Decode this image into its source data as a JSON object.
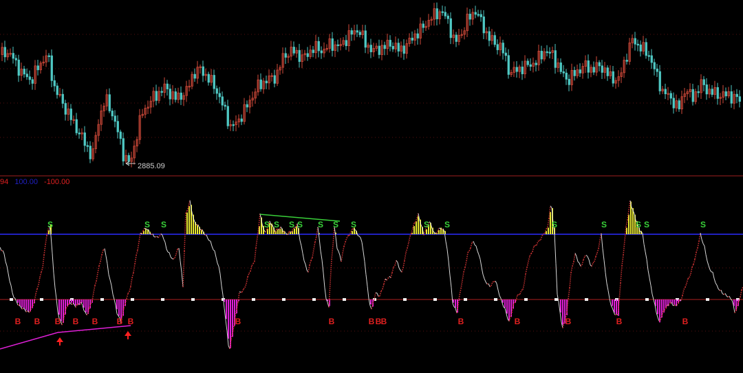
{
  "header": {
    "indicator_value": "94",
    "upper_level": "100.00",
    "lower_level": "-100.00"
  },
  "colors": {
    "background": "#000000",
    "candle_up": "#d24a3a",
    "candle_down": "#4fc9c4",
    "indicator_line": "#d8d8d8",
    "rising_dots": "#c83232",
    "sell_bars": "#e8e832",
    "buy_bars": "#e020d8",
    "sell_label": "#39d039",
    "buy_label": "#e02020",
    "upper_line": "#2020c0",
    "zero_line": "#b02020",
    "divergence_line_top": "#39d039",
    "divergence_line_bottom": "#e020d8",
    "arrow": "#ff2020"
  },
  "chart_data": [
    {
      "type": "candlestick",
      "panel": "price",
      "annotation": {
        "label": "2885.09",
        "points_to": "lowest low"
      },
      "close_path": [
        [
          0,
          3035
        ],
        [
          8,
          3040
        ],
        [
          18,
          3030
        ],
        [
          30,
          3010
        ],
        [
          45,
          3000
        ],
        [
          55,
          3020
        ],
        [
          68,
          3035
        ],
        [
          78,
          2990
        ],
        [
          92,
          2965
        ],
        [
          110,
          2935
        ],
        [
          125,
          2910
        ],
        [
          133,
          2895
        ],
        [
          142,
          2945
        ],
        [
          152,
          2975
        ],
        [
          160,
          2960
        ],
        [
          170,
          2930
        ],
        [
          178,
          2900
        ],
        [
          188,
          2885
        ],
        [
          195,
          2915
        ],
        [
          205,
          2955
        ],
        [
          220,
          2975
        ],
        [
          238,
          2990
        ],
        [
          255,
          2975
        ],
        [
          270,
          2985
        ],
        [
          280,
          3010
        ],
        [
          290,
          3015
        ],
        [
          300,
          3005
        ],
        [
          312,
          2990
        ],
        [
          325,
          2960
        ],
        [
          335,
          2935
        ],
        [
          345,
          2945
        ],
        [
          358,
          2965
        ],
        [
          372,
          2990
        ],
        [
          385,
          3000
        ],
        [
          400,
          3005
        ],
        [
          412,
          3035
        ],
        [
          425,
          3040
        ],
        [
          440,
          3030
        ],
        [
          455,
          3045
        ],
        [
          468,
          3040
        ],
        [
          480,
          3050
        ],
        [
          492,
          3045
        ],
        [
          505,
          3060
        ],
        [
          520,
          3070
        ],
        [
          530,
          3050
        ],
        [
          542,
          3040
        ],
        [
          555,
          3045
        ],
        [
          568,
          3050
        ],
        [
          580,
          3040
        ],
        [
          592,
          3050
        ],
        [
          600,
          3060
        ],
        [
          612,
          3070
        ],
        [
          625,
          3085
        ],
        [
          640,
          3095
        ],
        [
          650,
          3080
        ],
        [
          660,
          3050
        ],
        [
          670,
          3065
        ],
        [
          680,
          3085
        ],
        [
          690,
          3095
        ],
        [
          698,
          3080
        ],
        [
          708,
          3060
        ],
        [
          718,
          3050
        ],
        [
          728,
          3045
        ],
        [
          740,
          3010
        ],
        [
          752,
          3015
        ],
        [
          765,
          3020
        ],
        [
          778,
          3025
        ],
        [
          790,
          3040
        ],
        [
          802,
          3035
        ],
        [
          815,
          3010
        ],
        [
          825,
          3000
        ],
        [
          835,
          3010
        ],
        [
          848,
          3020
        ],
        [
          860,
          3015
        ],
        [
          872,
          3020
        ],
        [
          885,
          3005
        ],
        [
          898,
          3000
        ],
        [
          908,
          3030
        ],
        [
          918,
          3055
        ],
        [
          930,
          3045
        ],
        [
          942,
          3035
        ],
        [
          952,
          3010
        ],
        [
          962,
          2985
        ],
        [
          975,
          2975
        ],
        [
          985,
          2960
        ],
        [
          995,
          2990
        ],
        [
          1005,
          2975
        ],
        [
          1018,
          2995
        ],
        [
          1030,
          2985
        ],
        [
          1045,
          2980
        ],
        [
          1058,
          2980
        ],
        [
          1070,
          2975
        ],
        [
          1080,
          2970
        ]
      ]
    },
    {
      "type": "line",
      "panel": "indicator",
      "levels": {
        "upper": 100.0,
        "zero": 0,
        "lower": -100.0
      },
      "series": [
        {
          "values": [
            [
              0,
              80
            ],
            [
              6,
              70
            ],
            [
              12,
              40
            ],
            [
              18,
              10
            ],
            [
              22,
              0
            ],
            [
              28,
              -10
            ],
            [
              35,
              -15
            ],
            [
              42,
              -20
            ],
            [
              48,
              -10
            ],
            [
              55,
              20
            ],
            [
              62,
              50
            ],
            [
              68,
              100
            ],
            [
              73,
              115
            ],
            [
              78,
              40
            ],
            [
              84,
              -20
            ],
            [
              90,
              -40
            ],
            [
              97,
              -10
            ],
            [
              103,
              -5
            ],
            [
              110,
              -10
            ],
            [
              118,
              -5
            ],
            [
              126,
              -25
            ],
            [
              133,
              -5
            ],
            [
              140,
              30
            ],
            [
              147,
              65
            ],
            [
              152,
              80
            ],
            [
              158,
              40
            ],
            [
              164,
              10
            ],
            [
              170,
              -20
            ],
            [
              176,
              -35
            ],
            [
              182,
              -5
            ],
            [
              190,
              20
            ],
            [
              197,
              60
            ],
            [
              204,
              100
            ],
            [
              212,
              110
            ],
            [
              220,
              100
            ],
            [
              228,
              95
            ],
            [
              236,
              100
            ],
            [
              243,
              75
            ],
            [
              252,
              60
            ],
            [
              260,
              80
            ],
            [
              266,
              20
            ],
            [
              270,
              130
            ],
            [
              276,
              150
            ],
            [
              282,
              120
            ],
            [
              290,
              110
            ],
            [
              298,
              100
            ],
            [
              305,
              90
            ],
            [
              313,
              70
            ],
            [
              320,
              40
            ],
            [
              328,
              -30
            ],
            [
              333,
              -80
            ],
            [
              340,
              -40
            ],
            [
              348,
              10
            ],
            [
              355,
              15
            ],
            [
              362,
              40
            ],
            [
              370,
              60
            ],
            [
              378,
              130
            ],
            [
              385,
              100
            ],
            [
              392,
              120
            ],
            [
              400,
              105
            ],
            [
              408,
              110
            ],
            [
              416,
              100
            ],
            [
              424,
              105
            ],
            [
              432,
              115
            ],
            [
              440,
              70
            ],
            [
              447,
              40
            ],
            [
              455,
              70
            ],
            [
              462,
              110
            ],
            [
              468,
              60
            ],
            [
              474,
              0
            ],
            [
              478,
              -10
            ],
            [
              482,
              60
            ],
            [
              486,
              110
            ],
            [
              490,
              80
            ],
            [
              496,
              60
            ],
            [
              502,
              90
            ],
            [
              508,
              100
            ],
            [
              514,
              110
            ],
            [
              520,
              100
            ],
            [
              526,
              90
            ],
            [
              532,
              40
            ],
            [
              536,
              0
            ],
            [
              540,
              -15
            ],
            [
              546,
              10
            ],
            [
              552,
              5
            ],
            [
              560,
              30
            ],
            [
              568,
              35
            ],
            [
              576,
              60
            ],
            [
              584,
              40
            ],
            [
              592,
              80
            ],
            [
              600,
              110
            ],
            [
              608,
              130
            ],
            [
              616,
              100
            ],
            [
              624,
              120
            ],
            [
              632,
              100
            ],
            [
              640,
              110
            ],
            [
              646,
              105
            ],
            [
              652,
              60
            ],
            [
              658,
              -5
            ],
            [
              664,
              -20
            ],
            [
              672,
              30
            ],
            [
              680,
              70
            ],
            [
              688,
              90
            ],
            [
              696,
              70
            ],
            [
              704,
              30
            ],
            [
              712,
              20
            ],
            [
              720,
              30
            ],
            [
              728,
              0
            ],
            [
              734,
              -15
            ],
            [
              740,
              -35
            ],
            [
              746,
              -10
            ],
            [
              752,
              5
            ],
            [
              760,
              15
            ],
            [
              768,
              60
            ],
            [
              776,
              80
            ],
            [
              784,
              90
            ],
            [
              790,
              100
            ],
            [
              796,
              110
            ],
            [
              801,
              150
            ],
            [
              806,
              100
            ],
            [
              810,
              10
            ],
            [
              814,
              -20
            ],
            [
              818,
              -45
            ],
            [
              824,
              -20
            ],
            [
              830,
              40
            ],
            [
              836,
              70
            ],
            [
              844,
              50
            ],
            [
              852,
              70
            ],
            [
              860,
              50
            ],
            [
              868,
              70
            ],
            [
              874,
              100
            ],
            [
              880,
              40
            ],
            [
              886,
              0
            ],
            [
              892,
              -20
            ],
            [
              898,
              -25
            ],
            [
              904,
              50
            ],
            [
              910,
              110
            ],
            [
              916,
              150
            ],
            [
              922,
              130
            ],
            [
              928,
              110
            ],
            [
              934,
              100
            ],
            [
              940,
              60
            ],
            [
              946,
              20
            ],
            [
              952,
              -10
            ],
            [
              958,
              -35
            ],
            [
              966,
              -15
            ],
            [
              974,
              -5
            ],
            [
              982,
              -10
            ],
            [
              990,
              0
            ],
            [
              996,
              20
            ],
            [
              1004,
              40
            ],
            [
              1012,
              70
            ],
            [
              1018,
              100
            ],
            [
              1024,
              80
            ],
            [
              1030,
              50
            ],
            [
              1036,
              40
            ],
            [
              1042,
              20
            ],
            [
              1050,
              10
            ],
            [
              1058,
              5
            ],
            [
              1064,
              0
            ],
            [
              1068,
              -20
            ],
            [
              1072,
              -10
            ],
            [
              1080,
              20
            ]
          ]
        }
      ],
      "signals": {
        "S": [
          73,
          214,
          238,
          388,
          402,
          424,
          436,
          466,
          488,
          514,
          620,
          650,
          806,
          878,
          928,
          940,
          1022
        ],
        "B": [
          26,
          54,
          84,
          110,
          138,
          174,
          190,
          346,
          482,
          540,
          550,
          558,
          670,
          752,
          826,
          900,
          996
        ]
      }
    }
  ]
}
